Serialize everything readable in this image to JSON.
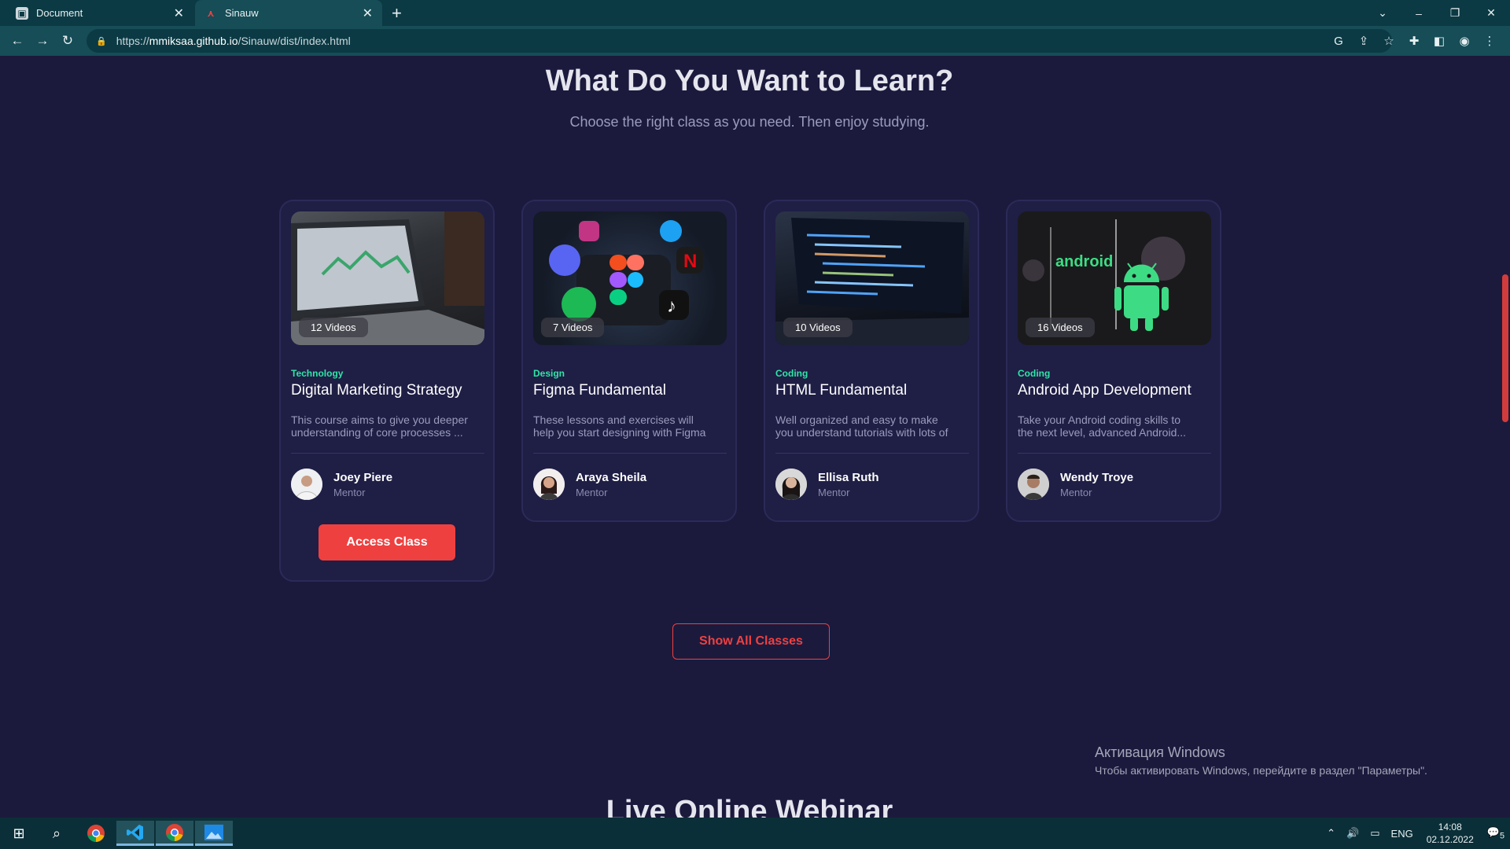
{
  "browser": {
    "tabs": [
      {
        "title": "Document",
        "active": false
      },
      {
        "title": "Sinauw",
        "active": true
      }
    ],
    "url_prefix": "https://",
    "url_host": "mmiksaa.github.io",
    "url_path": "/Sinauw/dist/index.html"
  },
  "section": {
    "title": "What Do You Want to Learn?",
    "subtitle": "Choose the right class as you need. Then enjoy studying."
  },
  "courses": [
    {
      "videos": "12 Videos",
      "category": "Technology",
      "title": "Digital Marketing Strategy",
      "desc1": "This course aims to give you deeper",
      "desc2": "understanding of core processes ...",
      "mentor": "Joey Piere",
      "role": "Mentor",
      "action": "Access Class"
    },
    {
      "videos": "7 Videos",
      "category": "Design",
      "title": "Figma Fundamental",
      "desc1": "These lessons and exercises will",
      "desc2": "help you start designing with Figma",
      "mentor": "Araya Sheila",
      "role": "Mentor"
    },
    {
      "videos": "10 Videos",
      "category": "Coding",
      "title": "HTML Fundamental",
      "desc1": "Well organized and easy to make",
      "desc2": "you understand tutorials with lots of",
      "mentor": "Ellisa Ruth",
      "role": "Mentor"
    },
    {
      "videos": "16 Videos",
      "category": "Coding",
      "title": "Android App Development",
      "desc1": "Take your Android coding skills to",
      "desc2": "the next level, advanced Android...",
      "mentor": "Wendy Troye",
      "role": "Mentor",
      "thumb_text": "android"
    }
  ],
  "show_all": "Show All Classes",
  "next_section_title": "Live Online Webinar",
  "watermark": {
    "title": "Активация Windows",
    "text": "Чтобы активировать Windows, перейдите в раздел \"Параметры\"."
  },
  "taskbar": {
    "lang": "ENG",
    "time": "14:08",
    "date": "02.12.2022",
    "notifications": "5"
  },
  "colors": {
    "page_bg": "#1b1a3d",
    "card_bg": "#1f1e45",
    "accent": "#ef4040",
    "category": "#2ee6a8"
  }
}
